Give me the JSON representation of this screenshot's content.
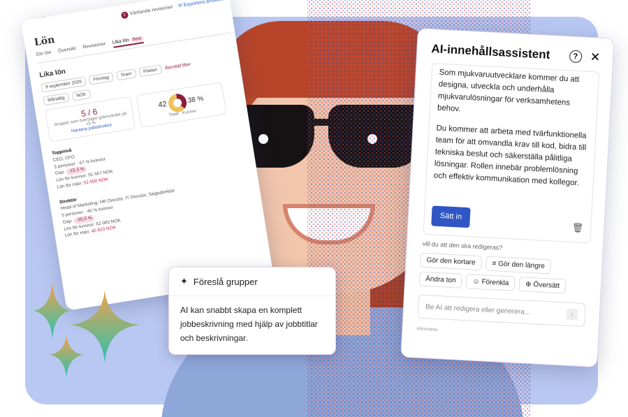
{
  "payroll": {
    "pending_count": "2",
    "pending_label": "Väntande revisioner",
    "export_label": "Exportera anställda",
    "title": "Lön",
    "tabs": [
      "Din lön",
      "Översikt",
      "Revisioner",
      "Lika lön"
    ],
    "beta": "Beta",
    "section_title": "Lika lön",
    "date": "9 september 2026",
    "filters": [
      "Företag",
      "Team",
      "Platser"
    ],
    "reset_filter": "Återställ filter",
    "period": "Månatlig",
    "currency": "NOK",
    "groups_value": "5 / 6",
    "groups_text": "Grupper som överstiger gränsvärdet på ±5 %",
    "manage_link": "Hantera jobbstruktur",
    "total_value": "42",
    "total_label": "Totalt",
    "women_percent": "38 %",
    "women_label": "Kvinnor",
    "levels": [
      {
        "name": "Toppnivå",
        "roles": "CEO, CFO",
        "people": "3 personer · 67 % kvinnor",
        "gap_label": "Gap:",
        "gap": "-15,3 %",
        "women_pay_label": "Lön för kvinnor:",
        "women_pay": "91 667 NOK",
        "men_pay_label": "Lön för män:",
        "men_pay": "52 000 NOK"
      },
      {
        "name": "Direktör",
        "roles": "Head of Marketing, HR Director, IT Director, Salgsdirektör",
        "people": "5 personer · 40 % kvinnor",
        "gap_label": "Gap:",
        "gap": "-35,5 %",
        "women_pay_label": "Lön för kvinnor:",
        "women_pay": "62 083 NOK",
        "men_pay_label": "Lön för män:",
        "men_pay": "45 833 NOK"
      }
    ]
  },
  "popup": {
    "title": "Föreslå grupper",
    "body": "AI kan snabbt skapa en komplett jobbeskrivning med hjälp av jobbtitlar och beskrivningar."
  },
  "ai": {
    "title": "AI-innehållsassistent",
    "paragraph1": "Som mjukvaruutvecklare kommer du att designa, utveckla och underhålla mjukvarulösningar för verksamhetens behov.",
    "paragraph2": "Du kommer att arbeta med tvärfunktionella team för att omvandla krav till kod, bidra till tekniska beslut och säkerställa pålitliga lösningar. Rollen innebär problemlösning och effektiv kommunikation med kollegor.",
    "insert_label": "Sätt in",
    "hint": "vill du att den ska redigeras?",
    "chips": [
      "Gör den kortare",
      "Gör den längre",
      "Ändra ton",
      "Förenkla",
      "Översätt"
    ],
    "input_placeholder": "Be AI att redigera eller generera...",
    "footer": "informera"
  },
  "colors": {
    "background": "#b9c8f2",
    "accent": "#8b1e3f",
    "primary_button": "#2f56c4"
  }
}
